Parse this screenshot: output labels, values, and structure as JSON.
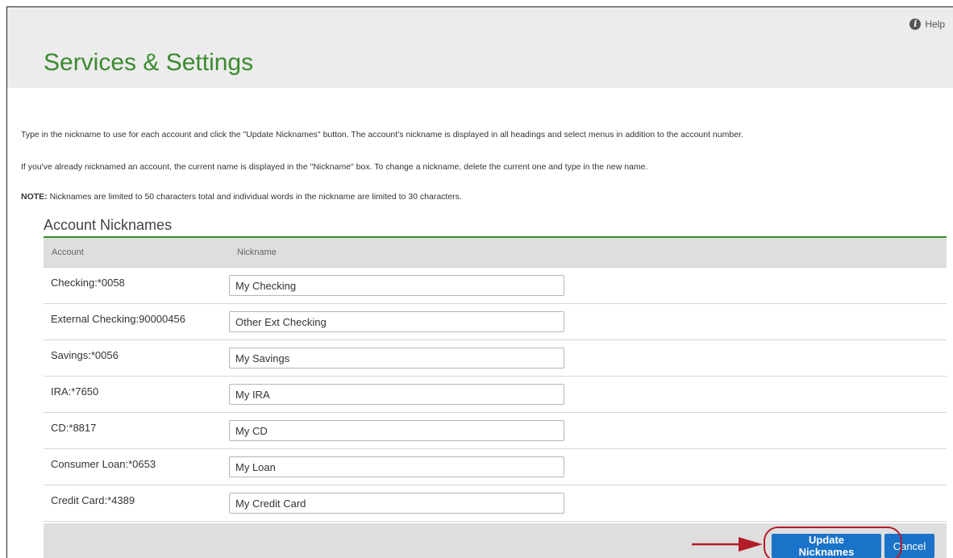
{
  "header": {
    "title": "Services & Settings",
    "help_label": "Help",
    "help_icon": "info-icon"
  },
  "intro": {
    "line1": "Type in the nickname to use for each account and click the \"Update Nicknames\" button. The account's nickname is displayed in all headings and select menus in addition to the account number.",
    "line2": "If you've already nicknamed an account, the current name is displayed in the \"Nickname\" box. To change a nickname, delete the current one and type in the new name.",
    "note_label": "NOTE:",
    "note_text": " Nicknames are limited to 50 characters total and individual words in the nickname are limited to 30 characters."
  },
  "section": {
    "title": "Account Nicknames",
    "columns": {
      "account": "Account",
      "nickname": "Nickname"
    },
    "rows": [
      {
        "account": "Checking:*0058",
        "nickname": "My Checking"
      },
      {
        "account": "External Checking:90000456",
        "nickname": "Other Ext Checking"
      },
      {
        "account": "Savings:*0056",
        "nickname": "My Savings"
      },
      {
        "account": "IRA:*7650",
        "nickname": "My IRA"
      },
      {
        "account": "CD:*8817",
        "nickname": "My CD"
      },
      {
        "account": "Consumer Loan:*0653",
        "nickname": "My Loan"
      },
      {
        "account": "Credit Card:*4389",
        "nickname": "My Credit Card"
      }
    ]
  },
  "footer": {
    "update_label": "Update Nicknames",
    "cancel_label": "Cancel"
  },
  "colors": {
    "title_green": "#3a8a2e",
    "button_blue": "#1a73c8",
    "callout_red": "#b31c2a"
  }
}
